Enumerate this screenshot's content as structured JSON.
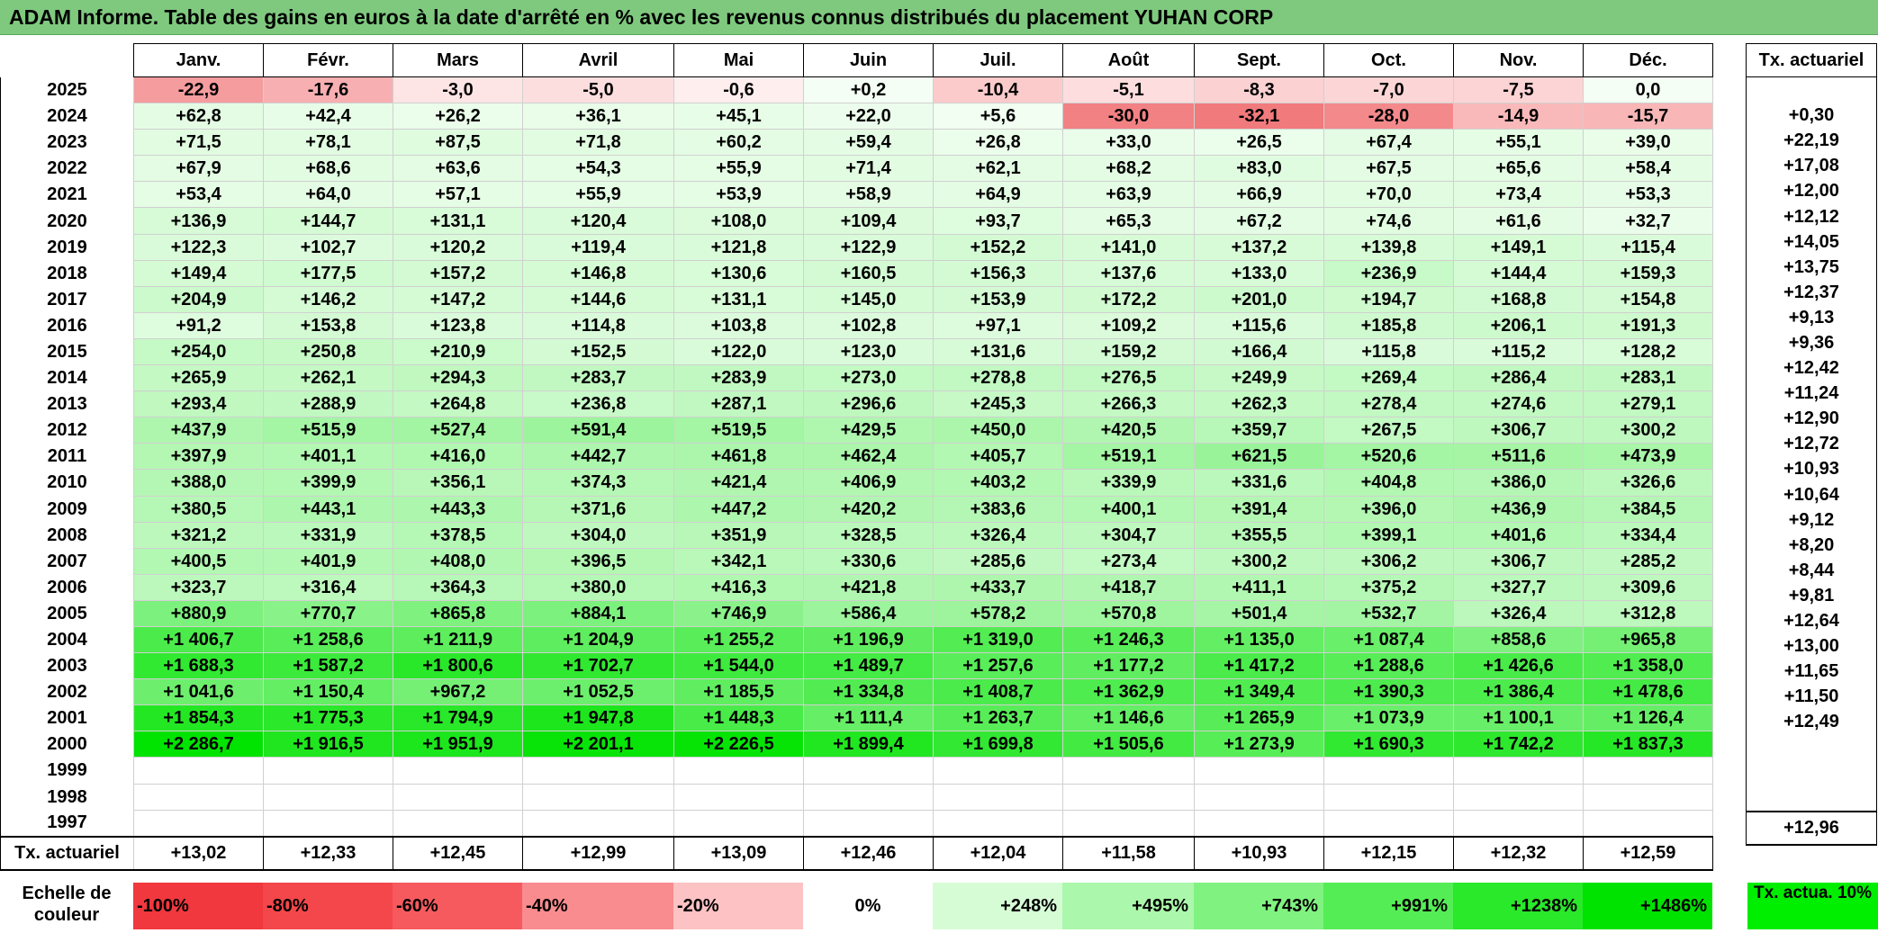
{
  "title": "ADAM Informe. Table des gains en euros à la date d'arrêté en % avec les revenus connus distribués du placement YUHAN CORP",
  "months": [
    "Janv.",
    "Févr.",
    "Mars",
    "Avril",
    "Mai",
    "Juin",
    "Juil.",
    "Août",
    "Sept.",
    "Oct.",
    "Nov.",
    "Déc."
  ],
  "right_header": "Tx. actuariel",
  "rows": [
    {
      "year": "2025",
      "values": [
        "-22,9",
        "-17,6",
        "-3,0",
        "-5,0",
        "-0,6",
        "+0,2",
        "-10,4",
        "-5,1",
        "-8,3",
        "-7,0",
        "-7,5",
        "0,0"
      ],
      "rate": ""
    },
    {
      "year": "2024",
      "values": [
        "+62,8",
        "+42,4",
        "+26,2",
        "+36,1",
        "+45,1",
        "+22,0",
        "+5,6",
        "-30,0",
        "-32,1",
        "-28,0",
        "-14,9",
        "-15,7"
      ],
      "rate": "+0,30"
    },
    {
      "year": "2023",
      "values": [
        "+71,5",
        "+78,1",
        "+87,5",
        "+71,8",
        "+60,2",
        "+59,4",
        "+26,8",
        "+33,0",
        "+26,5",
        "+67,4",
        "+55,1",
        "+39,0"
      ],
      "rate": "+22,19"
    },
    {
      "year": "2022",
      "values": [
        "+67,9",
        "+68,6",
        "+63,6",
        "+54,3",
        "+55,9",
        "+71,4",
        "+62,1",
        "+68,2",
        "+83,0",
        "+67,5",
        "+65,6",
        "+58,4"
      ],
      "rate": "+17,08"
    },
    {
      "year": "2021",
      "values": [
        "+53,4",
        "+64,0",
        "+57,1",
        "+55,9",
        "+53,9",
        "+58,9",
        "+64,9",
        "+63,9",
        "+66,9",
        "+70,0",
        "+73,4",
        "+53,3"
      ],
      "rate": "+12,00"
    },
    {
      "year": "2020",
      "values": [
        "+136,9",
        "+144,7",
        "+131,1",
        "+120,4",
        "+108,0",
        "+109,4",
        "+93,7",
        "+65,3",
        "+67,2",
        "+74,6",
        "+61,6",
        "+32,7"
      ],
      "rate": "+12,12"
    },
    {
      "year": "2019",
      "values": [
        "+122,3",
        "+102,7",
        "+120,2",
        "+119,4",
        "+121,8",
        "+122,9",
        "+152,2",
        "+141,0",
        "+137,2",
        "+139,8",
        "+149,1",
        "+115,4"
      ],
      "rate": "+14,05"
    },
    {
      "year": "2018",
      "values": [
        "+149,4",
        "+177,5",
        "+157,2",
        "+146,8",
        "+130,6",
        "+160,5",
        "+156,3",
        "+137,6",
        "+133,0",
        "+236,9",
        "+144,4",
        "+159,3"
      ],
      "rate": "+13,75"
    },
    {
      "year": "2017",
      "values": [
        "+204,9",
        "+146,2",
        "+147,2",
        "+144,6",
        "+131,1",
        "+145,0",
        "+153,9",
        "+172,2",
        "+201,0",
        "+194,7",
        "+168,8",
        "+154,8"
      ],
      "rate": "+12,37"
    },
    {
      "year": "2016",
      "values": [
        "+91,2",
        "+153,8",
        "+123,8",
        "+114,8",
        "+103,8",
        "+102,8",
        "+97,1",
        "+109,2",
        "+115,6",
        "+185,8",
        "+206,1",
        "+191,3"
      ],
      "rate": "+9,13"
    },
    {
      "year": "2015",
      "values": [
        "+254,0",
        "+250,8",
        "+210,9",
        "+152,5",
        "+122,0",
        "+123,0",
        "+131,6",
        "+159,2",
        "+166,4",
        "+115,8",
        "+115,2",
        "+128,2"
      ],
      "rate": "+9,36"
    },
    {
      "year": "2014",
      "values": [
        "+265,9",
        "+262,1",
        "+294,3",
        "+283,7",
        "+283,9",
        "+273,0",
        "+278,8",
        "+276,5",
        "+249,9",
        "+269,4",
        "+286,4",
        "+283,1"
      ],
      "rate": "+12,42"
    },
    {
      "year": "2013",
      "values": [
        "+293,4",
        "+288,9",
        "+264,8",
        "+236,8",
        "+287,1",
        "+296,6",
        "+245,3",
        "+266,3",
        "+262,3",
        "+278,4",
        "+274,6",
        "+279,1"
      ],
      "rate": "+11,24"
    },
    {
      "year": "2012",
      "values": [
        "+437,9",
        "+515,9",
        "+527,4",
        "+591,4",
        "+519,5",
        "+429,5",
        "+450,0",
        "+420,5",
        "+359,7",
        "+267,5",
        "+306,7",
        "+300,2"
      ],
      "rate": "+12,90"
    },
    {
      "year": "2011",
      "values": [
        "+397,9",
        "+401,1",
        "+416,0",
        "+442,7",
        "+461,8",
        "+462,4",
        "+405,7",
        "+519,1",
        "+621,5",
        "+520,6",
        "+511,6",
        "+473,9"
      ],
      "rate": "+12,72"
    },
    {
      "year": "2010",
      "values": [
        "+388,0",
        "+399,9",
        "+356,1",
        "+374,3",
        "+421,4",
        "+406,9",
        "+403,2",
        "+339,9",
        "+331,6",
        "+404,8",
        "+386,0",
        "+326,6"
      ],
      "rate": "+10,93"
    },
    {
      "year": "2009",
      "values": [
        "+380,5",
        "+443,1",
        "+443,3",
        "+371,6",
        "+447,2",
        "+420,2",
        "+383,6",
        "+400,1",
        "+391,4",
        "+396,0",
        "+436,9",
        "+384,5"
      ],
      "rate": "+10,64"
    },
    {
      "year": "2008",
      "values": [
        "+321,2",
        "+331,9",
        "+378,5",
        "+304,0",
        "+351,9",
        "+328,5",
        "+326,4",
        "+304,7",
        "+355,5",
        "+399,1",
        "+401,6",
        "+334,4"
      ],
      "rate": "+9,12"
    },
    {
      "year": "2007",
      "values": [
        "+400,5",
        "+401,9",
        "+408,0",
        "+396,5",
        "+342,1",
        "+330,6",
        "+285,6",
        "+273,4",
        "+300,2",
        "+306,2",
        "+306,7",
        "+285,2"
      ],
      "rate": "+8,20"
    },
    {
      "year": "2006",
      "values": [
        "+323,7",
        "+316,4",
        "+364,3",
        "+380,0",
        "+416,3",
        "+421,8",
        "+433,7",
        "+418,7",
        "+411,1",
        "+375,2",
        "+327,7",
        "+309,6"
      ],
      "rate": "+8,44"
    },
    {
      "year": "2005",
      "values": [
        "+880,9",
        "+770,7",
        "+865,8",
        "+884,1",
        "+746,9",
        "+586,4",
        "+578,2",
        "+570,8",
        "+501,4",
        "+532,7",
        "+326,4",
        "+312,8"
      ],
      "rate": "+9,81"
    },
    {
      "year": "2004",
      "values": [
        "+1 406,7",
        "+1 258,6",
        "+1 211,9",
        "+1 204,9",
        "+1 255,2",
        "+1 196,9",
        "+1 319,0",
        "+1 246,3",
        "+1 135,0",
        "+1 087,4",
        "+858,6",
        "+965,8"
      ],
      "rate": "+12,64"
    },
    {
      "year": "2003",
      "values": [
        "+1 688,3",
        "+1 587,2",
        "+1 800,6",
        "+1 702,7",
        "+1 544,0",
        "+1 489,7",
        "+1 257,6",
        "+1 177,2",
        "+1 417,2",
        "+1 288,6",
        "+1 426,6",
        "+1 358,0"
      ],
      "rate": "+13,00"
    },
    {
      "year": "2002",
      "values": [
        "+1 041,6",
        "+1 150,4",
        "+967,2",
        "+1 052,5",
        "+1 185,5",
        "+1 334,8",
        "+1 408,7",
        "+1 362,9",
        "+1 349,4",
        "+1 390,3",
        "+1 386,4",
        "+1 478,6"
      ],
      "rate": "+11,65"
    },
    {
      "year": "2001",
      "values": [
        "+1 854,3",
        "+1 775,3",
        "+1 794,9",
        "+1 947,8",
        "+1 448,3",
        "+1 111,4",
        "+1 263,7",
        "+1 146,6",
        "+1 265,9",
        "+1 073,9",
        "+1 100,1",
        "+1 126,4"
      ],
      "rate": "+11,50"
    },
    {
      "year": "2000",
      "values": [
        "+2 286,7",
        "+1 916,5",
        "+1 951,9",
        "+2 201,1",
        "+2 226,5",
        "+1 899,4",
        "+1 699,8",
        "+1 505,6",
        "+1 273,9",
        "+1 690,3",
        "+1 742,2",
        "+1 837,3"
      ],
      "rate": "+12,49"
    },
    {
      "year": "1999",
      "values": [
        "",
        "",
        "",
        "",
        "",
        "",
        "",
        "",
        "",
        "",
        "",
        ""
      ],
      "rate": ""
    },
    {
      "year": "1998",
      "values": [
        "",
        "",
        "",
        "",
        "",
        "",
        "",
        "",
        "",
        "",
        "",
        ""
      ],
      "rate": ""
    },
    {
      "year": "1997",
      "values": [
        "",
        "",
        "",
        "",
        "",
        "",
        "",
        "",
        "",
        "",
        "",
        ""
      ],
      "rate": ""
    }
  ],
  "tx_row": {
    "label": "Tx. actuariel",
    "values": [
      "+13,02",
      "+12,33",
      "+12,45",
      "+12,99",
      "+13,09",
      "+12,46",
      "+12,04",
      "+11,58",
      "+10,93",
      "+12,15",
      "+12,32",
      "+12,59"
    ],
    "total": "+12,96"
  },
  "legend": {
    "label": "Echelle de couleur",
    "cells": [
      {
        "text": "-100%",
        "color": "#f0383e",
        "kind": "neg"
      },
      {
        "text": "-80%",
        "color": "#f3474b",
        "kind": "neg"
      },
      {
        "text": "-60%",
        "color": "#f65a5e",
        "kind": "neg"
      },
      {
        "text": "-40%",
        "color": "#f98c8f",
        "kind": "neg"
      },
      {
        "text": "-20%",
        "color": "#fcc2c4",
        "kind": "neg"
      },
      {
        "text": "0%",
        "color": "#ffffff",
        "kind": "zero"
      },
      {
        "text": "+248%",
        "color": "#d6fcd6",
        "kind": "pos"
      },
      {
        "text": "+495%",
        "color": "#abf7ab",
        "kind": "pos"
      },
      {
        "text": "+743%",
        "color": "#80f280",
        "kind": "pos"
      },
      {
        "text": "+991%",
        "color": "#55ed55",
        "kind": "pos"
      },
      {
        "text": "+1238%",
        "color": "#2ae82a",
        "kind": "pos"
      },
      {
        "text": "+1486%",
        "color": "#00e300",
        "kind": "pos"
      }
    ],
    "actua_label": "Tx. actua. 10%",
    "actua_color": "#00ee00"
  }
}
